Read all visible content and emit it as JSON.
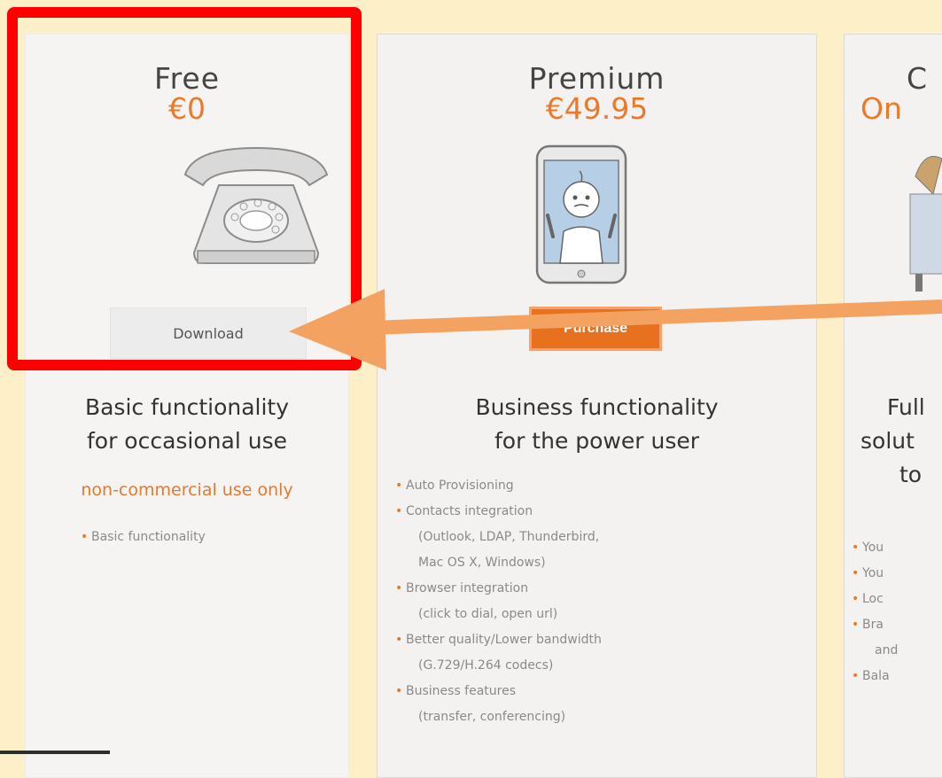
{
  "plans": {
    "free": {
      "name": "Free",
      "price": "€0",
      "button": "Download",
      "headline_line1": "Basic functionality",
      "headline_line2": "for occasional use",
      "note": "non-commercial use only",
      "features": [
        "Basic functionality"
      ]
    },
    "premium": {
      "name": "Premium",
      "price": "€49.95",
      "button": "Purchase",
      "headline_line1": "Business functionality",
      "headline_line2": "for the power user",
      "features": [
        "Auto Provisioning",
        "Contacts integration",
        "(Outlook, LDAP, Thunderbird,",
        "Mac OS X, Windows)",
        "Browser integration",
        "(click to dial, open url)",
        "Better quality/Lower bandwidth",
        "(G.729/H.264 codecs)",
        "Business features",
        "(transfer, conferencing)"
      ]
    },
    "third": {
      "name": "C",
      "price": "On",
      "headline_line1": "Full",
      "headline_line2": "solut",
      "headline_line3": "to",
      "features": [
        "You",
        "You",
        "Loc",
        "Bra",
        "and",
        "Bala"
      ]
    }
  },
  "colors": {
    "accent": "#ea7a2a",
    "highlight": "#ff0000",
    "arrow": "#f4a261",
    "background": "#fdf0c8"
  },
  "icons": {
    "free": "rotary-telephone-icon",
    "premium": "mobile-phone-icon",
    "third": "person-icon"
  }
}
